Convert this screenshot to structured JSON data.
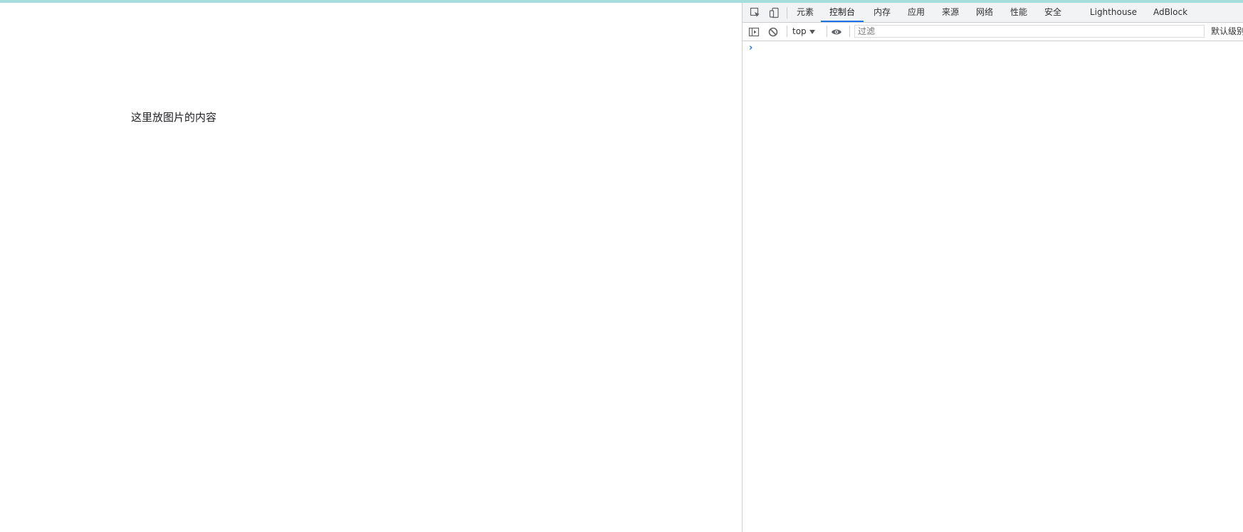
{
  "page": {
    "content_text": "这里放图片的内容"
  },
  "devtools": {
    "tabs": [
      {
        "label": "元素"
      },
      {
        "label": "控制台",
        "active": true
      },
      {
        "label": "内存"
      },
      {
        "label": "应用"
      },
      {
        "label": "来源"
      },
      {
        "label": "网络"
      },
      {
        "label": "性能"
      },
      {
        "label": "安全"
      },
      {
        "label": "Lighthouse"
      },
      {
        "label": "AdBlock"
      }
    ],
    "toolbar": {
      "context": "top",
      "filter_placeholder": "过滤",
      "levels_label": "默认级别"
    },
    "console": {
      "prompt": "›"
    },
    "colors": {
      "accent": "#1a73e8",
      "top_accent": "#a6dede"
    },
    "icons": [
      "inspect-element-icon",
      "device-toolbar-icon",
      "sidebar-toggle-icon",
      "clear-console-icon",
      "eye-icon"
    ]
  }
}
